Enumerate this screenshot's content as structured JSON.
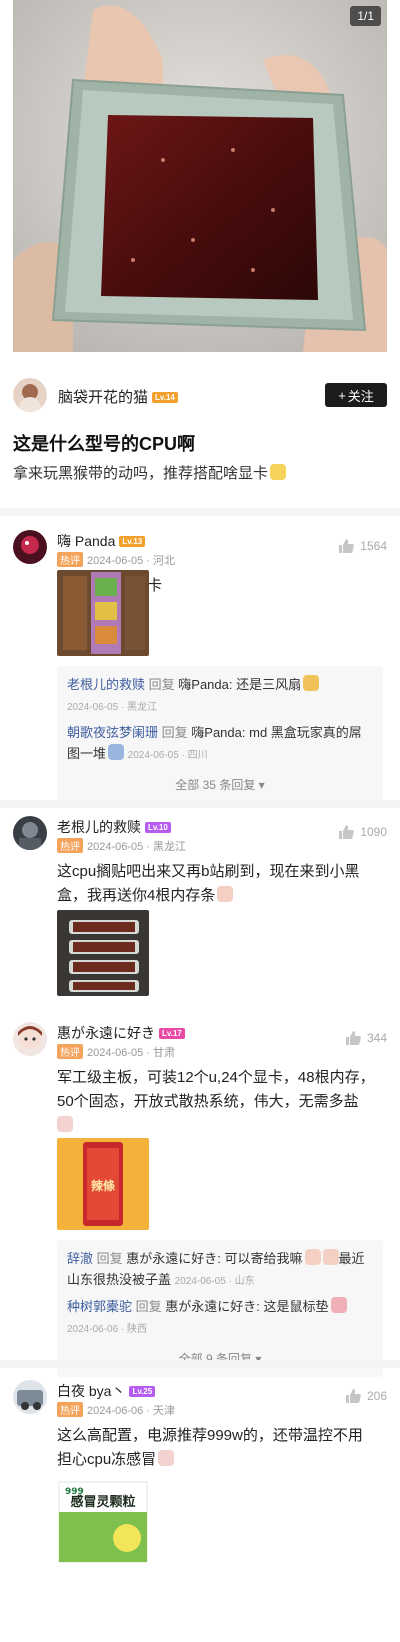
{
  "page_counter": "1/1",
  "author": {
    "name": "脑袋开花的猫",
    "level": "Lv.14",
    "follow_label": "关注"
  },
  "post": {
    "title": "这是什么型号的CPU啊",
    "body": "拿来玩黑猴带的动吗，推荐搭配啥显卡"
  },
  "comments": [
    {
      "name": "嗨 Panda",
      "level": "Lv.13",
      "hot": "热评",
      "meta": "2024-06-05 · 河北",
      "likes": "1564",
      "text": "推荐配这款显卡",
      "replies": [
        {
          "name": "老根儿的救赎",
          "reply_word": "回复",
          "target": "嗨Panda:",
          "text": "还是三风扇",
          "meta": "2024-06-05 · 黑龙江"
        },
        {
          "name": "朝歌夜弦梦阑珊",
          "reply_word": "回复",
          "target": "嗨Panda:",
          "text": "md 黑盒玩家真的屌图一堆",
          "meta": "2024-06-05 · 四川"
        }
      ],
      "all_replies": "全部 35 条回复"
    },
    {
      "name": "老根儿的救赎",
      "level": "Lv.10",
      "hot": "热评",
      "meta": "2024-06-05 · 黑龙江",
      "likes": "1090",
      "text": "这cpu搁贴吧出来又再b站刷到，现在来到小黑盒，我再送你4根内存条"
    },
    {
      "name": "惠が永遠に好き",
      "level": "Lv.17",
      "hot": "热评",
      "meta": "2024-06-05 · 甘肃",
      "likes": "344",
      "text": "军工级主板，可装12个u,24个显卡，48根内存，50个固态，开放式散热系统，伟大，无需多盐",
      "image_text": "辣條",
      "replies": [
        {
          "name": "辞澈",
          "reply_word": "回复",
          "target": "惠が永遠に好き:",
          "text": "可以寄给我嘛",
          "text2": "最近山东很热没被子盖",
          "meta": "2024-06-05 · 山东"
        },
        {
          "name": "种树郭橐驼",
          "reply_word": "回复",
          "target": "惠が永遠に好き:",
          "text": "这是鼠标垫",
          "meta": "2024-06-06 · 陕西"
        }
      ],
      "all_replies": "全部 9 条回复"
    },
    {
      "name": "白夜 bya丶",
      "level": "Lv.25",
      "hot": "热评",
      "meta": "2024-06-06 · 天津",
      "likes": "206",
      "text": "这么高配置，电源推荐999w的，还带温控不用担心cpu冻感冒",
      "image_brand": "999",
      "image_text": "感冒灵颗粒"
    }
  ],
  "colors": {
    "accent_link": "#3f5fa0",
    "hot_tag": "#f4a35b",
    "follow_bg": "#1c1c1c"
  }
}
